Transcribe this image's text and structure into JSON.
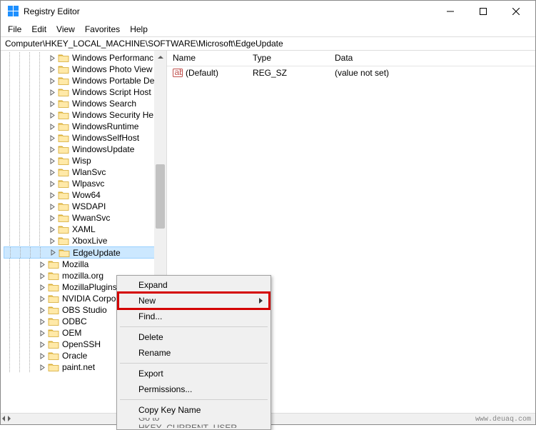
{
  "window": {
    "title": "Registry Editor"
  },
  "menu": {
    "items": [
      "File",
      "Edit",
      "View",
      "Favorites",
      "Help"
    ]
  },
  "address": {
    "path": "Computer\\HKEY_LOCAL_MACHINE\\SOFTWARE\\Microsoft\\EdgeUpdate"
  },
  "tree": {
    "items": [
      {
        "label": "Windows Performanc",
        "indent": 4,
        "exp": "closed"
      },
      {
        "label": "Windows Photo View",
        "indent": 4,
        "exp": "closed"
      },
      {
        "label": "Windows Portable De",
        "indent": 4,
        "exp": "closed"
      },
      {
        "label": "Windows Script Host",
        "indent": 4,
        "exp": "closed"
      },
      {
        "label": "Windows Search",
        "indent": 4,
        "exp": "closed"
      },
      {
        "label": "Windows Security He",
        "indent": 4,
        "exp": "closed"
      },
      {
        "label": "WindowsRuntime",
        "indent": 4,
        "exp": "closed"
      },
      {
        "label": "WindowsSelfHost",
        "indent": 4,
        "exp": "closed"
      },
      {
        "label": "WindowsUpdate",
        "indent": 4,
        "exp": "closed"
      },
      {
        "label": "Wisp",
        "indent": 4,
        "exp": "closed"
      },
      {
        "label": "WlanSvc",
        "indent": 4,
        "exp": "closed"
      },
      {
        "label": "Wlpasvc",
        "indent": 4,
        "exp": "closed"
      },
      {
        "label": "Wow64",
        "indent": 4,
        "exp": "closed"
      },
      {
        "label": "WSDAPI",
        "indent": 4,
        "exp": "closed"
      },
      {
        "label": "WwanSvc",
        "indent": 4,
        "exp": "closed"
      },
      {
        "label": "XAML",
        "indent": 4,
        "exp": "closed"
      },
      {
        "label": "XboxLive",
        "indent": 4,
        "exp": "closed"
      },
      {
        "label": "EdgeUpdate",
        "indent": 4,
        "exp": "closed",
        "selected": true
      },
      {
        "label": "Mozilla",
        "indent": 3,
        "exp": "closed"
      },
      {
        "label": "mozilla.org",
        "indent": 3,
        "exp": "closed"
      },
      {
        "label": "MozillaPlugins",
        "indent": 3,
        "exp": "closed"
      },
      {
        "label": "NVIDIA Corporation",
        "indent": 3,
        "exp": "closed"
      },
      {
        "label": "OBS Studio",
        "indent": 3,
        "exp": "closed"
      },
      {
        "label": "ODBC",
        "indent": 3,
        "exp": "closed"
      },
      {
        "label": "OEM",
        "indent": 3,
        "exp": "closed"
      },
      {
        "label": "OpenSSH",
        "indent": 3,
        "exp": "closed"
      },
      {
        "label": "Oracle",
        "indent": 3,
        "exp": "closed"
      },
      {
        "label": "paint.net",
        "indent": 3,
        "exp": "closed"
      }
    ]
  },
  "list": {
    "columns": {
      "name": "Name",
      "type": "Type",
      "data": "Data"
    },
    "rows": [
      {
        "name": "(Default)",
        "type": "REG_SZ",
        "data": "(value not set)"
      }
    ]
  },
  "context_menu": {
    "items": [
      {
        "label": "Expand",
        "type": "item"
      },
      {
        "label": "New",
        "type": "submenu",
        "highlight": true
      },
      {
        "label": "Find...",
        "type": "item"
      },
      {
        "type": "sep"
      },
      {
        "label": "Delete",
        "type": "item"
      },
      {
        "label": "Rename",
        "type": "item"
      },
      {
        "type": "sep"
      },
      {
        "label": "Export",
        "type": "item"
      },
      {
        "label": "Permissions...",
        "type": "item"
      },
      {
        "type": "sep"
      },
      {
        "label": "Copy Key Name",
        "type": "item"
      },
      {
        "label": "Go to HKEY_CURRENT_USER",
        "type": "item",
        "cut": true
      }
    ]
  },
  "watermark": "www.deuaq.com"
}
